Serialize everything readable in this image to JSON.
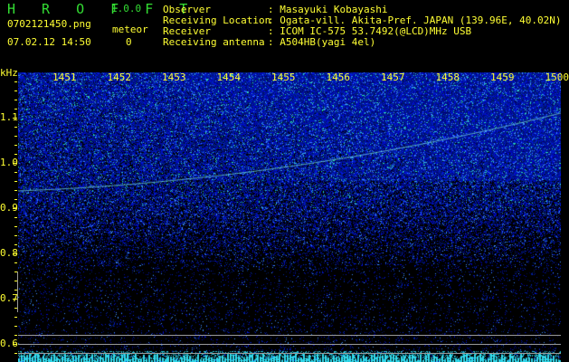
{
  "app": {
    "title": "H R O F F T",
    "version": "1.0.0"
  },
  "file": {
    "name": "0702121450.png",
    "datetime": "07.02.12 14:50"
  },
  "meteor": {
    "label": "meteor",
    "count": "0"
  },
  "info": [
    {
      "label": "Observer",
      "value": ": Masayuki Kobayashi"
    },
    {
      "label": "Receiving Location",
      "value": ": Ogata-vill. Akita-Pref. JAPAN (139.96E, 40.02N)"
    },
    {
      "label": "Receiver",
      "value": ": ICOM IC-575 53.7492(@LCD)MHz USB"
    },
    {
      "label": "Receiving antenna",
      "value": ": A504HB(yagi 4el)"
    }
  ],
  "spectrogram": {
    "y_unit": "kHz",
    "time_labels": [
      "1451",
      "1452",
      "1453",
      "1454",
      "1455",
      "1456",
      "1457",
      "1458",
      "1459",
      "1500"
    ],
    "freq_labels": [
      "1.1",
      "1.0",
      "0.9",
      "0.8",
      "0.7",
      "0.6"
    ]
  }
}
